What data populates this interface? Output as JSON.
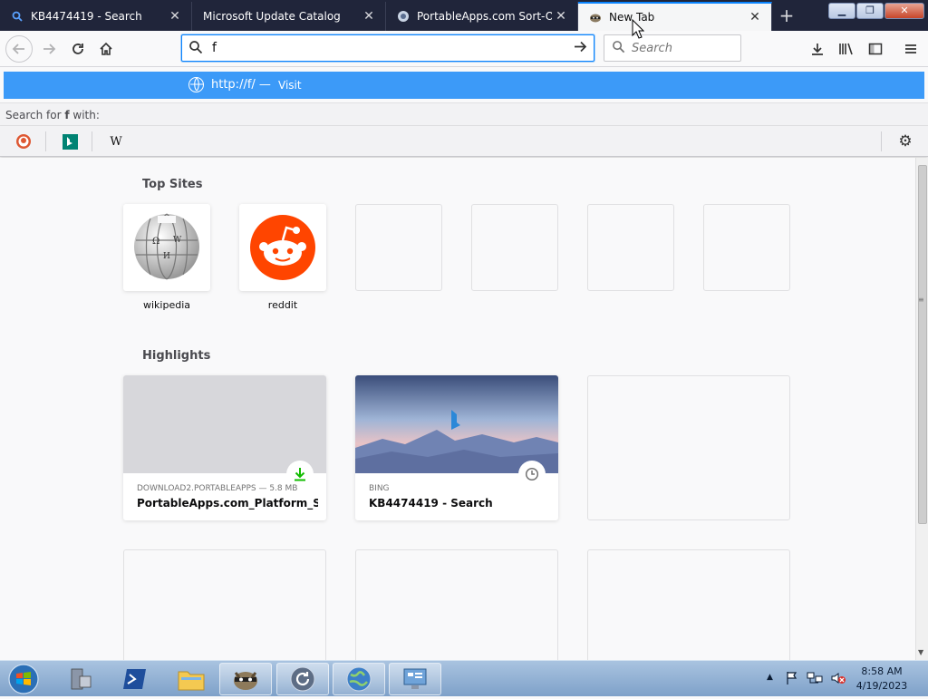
{
  "tabs": [
    {
      "title": "KB4474419 - Search",
      "favicon": "search-favicon"
    },
    {
      "title": "Microsoft Update Catalog",
      "favicon": ""
    },
    {
      "title": "PortableApps.com Sort-Of-N",
      "favicon": "portableapps-favicon"
    },
    {
      "title": "New Tab",
      "favicon": "raccoon-favicon",
      "active": true
    }
  ],
  "toolbar": {
    "url_value": "f",
    "search_placeholder": "Search"
  },
  "urlbar_popup": {
    "visit_url": "http://f/ —",
    "visit_label": "Visit",
    "search_with_prefix": "Search for ",
    "search_term": "f",
    "search_with_suffix": " with:",
    "engines": [
      "duckduckgo",
      "bing",
      "wikipedia"
    ],
    "wikipedia_glyph": "W"
  },
  "newtab": {
    "top_sites_title": "Top Sites",
    "top_sites": [
      {
        "label": "wikipedia"
      },
      {
        "label": "reddit"
      },
      {
        "label": ""
      },
      {
        "label": ""
      },
      {
        "label": ""
      },
      {
        "label": ""
      }
    ],
    "highlights_title": "Highlights",
    "highlights": [
      {
        "source": "DOWNLOAD2.PORTABLEAPPS — 5.8 MB",
        "title": "PortableApps.com_Platform_Set...",
        "badge": "download-icon"
      },
      {
        "source": "BING",
        "title": "KB4474419 - Search",
        "badge": "clock-icon"
      }
    ]
  },
  "taskbar": {
    "clock_time": "8:58 AM",
    "clock_date": "4/19/2023"
  },
  "colors": {
    "accent": "#0a84ff",
    "visit_row": "#3c9af8",
    "tabstrip": "#20253a",
    "reddit": "#ff4500",
    "download_green": "#12bc00"
  }
}
